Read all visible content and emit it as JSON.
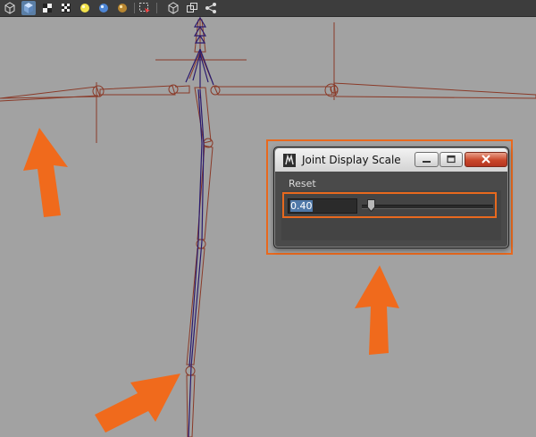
{
  "toolbar": {
    "icons": [
      "wireframe-cube-icon",
      "shaded-cube-icon",
      "checker-texture-icon",
      "default-light-icon",
      "lights-sphere-icon",
      "shadows-sphere-icon",
      "isolate-select-icon",
      "xray-icon",
      "xray-joints-icon",
      "hierarchy-icon"
    ]
  },
  "dialog": {
    "title": "Joint Display Scale",
    "menu_reset": "Reset",
    "scale_value": "0.40",
    "scale_fraction": 0.04,
    "window_buttons": [
      "minimize",
      "maximize",
      "close"
    ]
  },
  "colors": {
    "viewport_bg": "#a2a2a2",
    "joint_color": "#8a3a28",
    "bone_line": "#2a1a6e",
    "highlight": "#e8691e",
    "dialog_bg": "#4a4a4a",
    "selection": "#4f78a8"
  }
}
